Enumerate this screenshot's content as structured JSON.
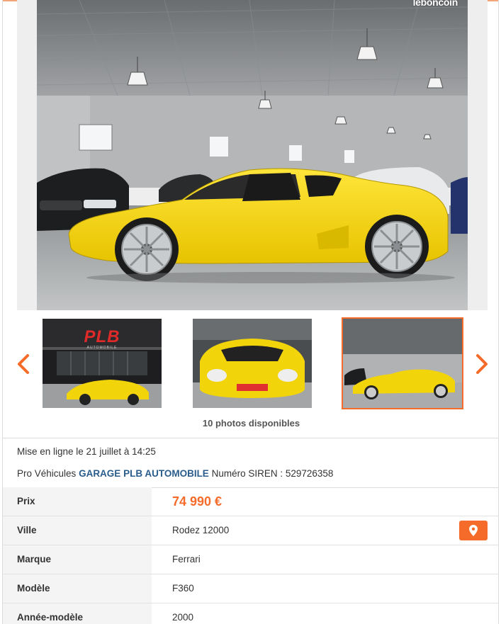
{
  "watermark": "leboncoin",
  "gallery": {
    "photos_count": "10 photos disponibles",
    "thumb1": {
      "brand": "PLB",
      "subtitle": "AUTOMOBILE"
    },
    "prev_icon": "chevron-left-icon",
    "next_icon": "chevron-right-icon"
  },
  "listing": {
    "posted_at": "Mise en ligne le 21 juillet à 14:25",
    "seller_prefix": "Pro Véhicules",
    "seller_name": "GARAGE PLB AUTOMOBILE",
    "siren": "Numéro SIREN : 529726358"
  },
  "details": [
    {
      "label": "Prix",
      "value": "74 990 €"
    },
    {
      "label": "Ville",
      "value": "Rodez 12000"
    },
    {
      "label": "Marque",
      "value": "Ferrari"
    },
    {
      "label": "Modèle",
      "value": "F360"
    },
    {
      "label": "Année-modèle",
      "value": "2000"
    }
  ],
  "colors": {
    "accent": "#f56b2a",
    "link": "#2a5d8c",
    "car_yellow": "#f2d40a"
  },
  "map_button_icon": "map-pin-icon"
}
